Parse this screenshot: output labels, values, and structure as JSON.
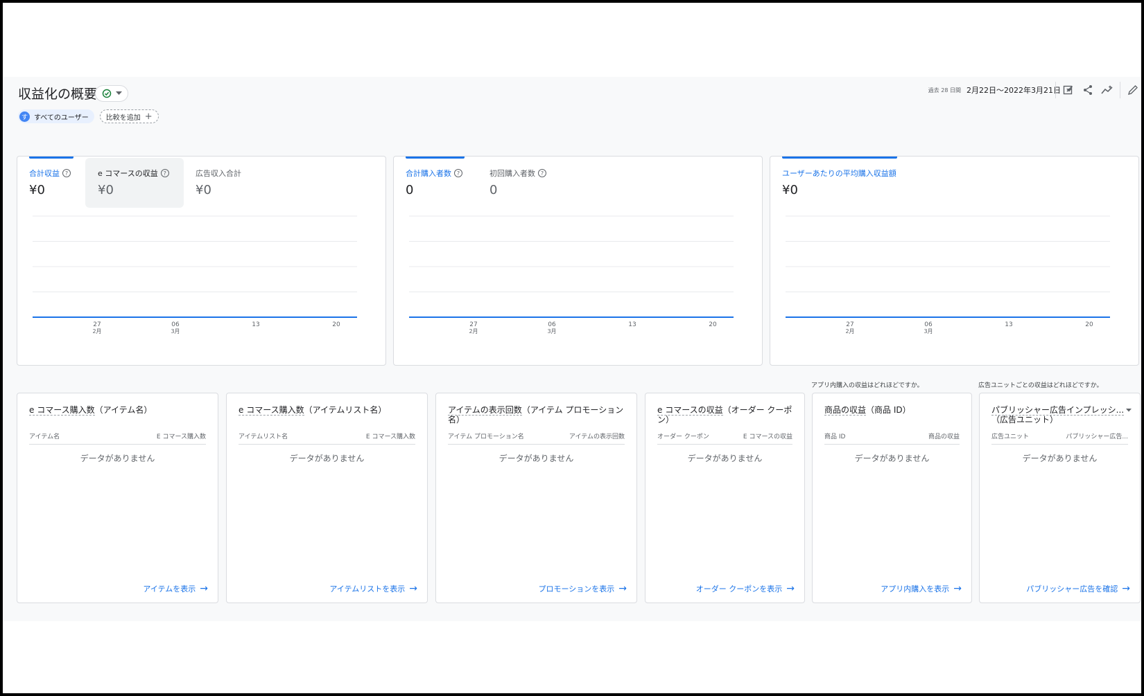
{
  "header": {
    "title": "収益化の概要",
    "date_prefix": "過去 28 日間",
    "date_range": "2月22日～2022年3月21日",
    "segment_label": "すべてのユーザー",
    "segment_avatar": "す",
    "compare_label": "比較を追加"
  },
  "metric_cards": [
    {
      "metrics": [
        {
          "label": "合計収益",
          "value": "¥0"
        },
        {
          "label": "e コマースの収益",
          "value": "¥0"
        },
        {
          "label": "広告収入合計",
          "value": "¥0"
        }
      ]
    },
    {
      "metrics": [
        {
          "label": "合計購入者数",
          "value": "0"
        },
        {
          "label": "初回購入者数",
          "value": "0"
        }
      ]
    },
    {
      "metrics": [
        {
          "label": "ユーザーあたりの平均購入収益額",
          "value": "¥0"
        }
      ]
    }
  ],
  "chart_data": [
    {
      "type": "line",
      "x": [
        "27 2月",
        "06 3月",
        "13",
        "20"
      ],
      "x_tick_days": [
        "27",
        "06",
        "13",
        "20"
      ],
      "x_tick_months": [
        "2月",
        "3月",
        "",
        ""
      ],
      "series": [
        {
          "values": [
            0,
            0,
            0,
            0
          ]
        }
      ],
      "grid": true
    },
    {
      "type": "line",
      "x": [
        "27 2月",
        "06 3月",
        "13",
        "20"
      ],
      "x_tick_days": [
        "27",
        "06",
        "13",
        "20"
      ],
      "x_tick_months": [
        "2月",
        "3月",
        "",
        ""
      ],
      "series": [
        {
          "values": [
            0,
            0,
            0,
            0
          ]
        }
      ],
      "grid": true
    },
    {
      "type": "line",
      "x": [
        "27 2月",
        "06 3月",
        "13",
        "20"
      ],
      "x_tick_days": [
        "27",
        "06",
        "13",
        "20"
      ],
      "x_tick_months": [
        "2月",
        "3月",
        "",
        ""
      ],
      "series": [
        {
          "values": [
            0,
            0,
            0,
            0
          ]
        }
      ],
      "grid": true
    }
  ],
  "questions": {
    "q1": "アプリ内購入の収益はどれほどですか。",
    "q2": "広告ユニットごとの収益はどれほどですか。"
  },
  "bottom_cards": [
    {
      "title_main": "e コマース購入数",
      "title_sub": "（アイテム名）",
      "col1": "アイテム名",
      "col2": "E コマース購入数",
      "empty": "データがありません",
      "link": "アイテムを表示"
    },
    {
      "title_main": "e コマース購入数",
      "title_sub": "（アイテムリスト名）",
      "col1": "アイテムリスト名",
      "col2": "E コマース購入数",
      "empty": "データがありません",
      "link": "アイテムリストを表示"
    },
    {
      "title_main": "アイテムの表示回数",
      "title_sub": "（アイテム プロモーション名）",
      "col1": "アイテム プロモーション名",
      "col2": "アイテムの表示回数",
      "empty": "データがありません",
      "link": "プロモーションを表示"
    },
    {
      "title_main": "e コマースの収益",
      "title_sub": "（オーダー クーポン）",
      "col1": "オーダー クーポン",
      "col2": "E コマースの収益",
      "empty": "データがありません",
      "link": "オーダー クーポンを表示"
    },
    {
      "title_main": "商品の収益",
      "title_sub": "（商品 ID）",
      "col1": "商品 ID",
      "col2": "商品の収益",
      "empty": "データがありません",
      "link": "アプリ内購入を表示"
    },
    {
      "title_main": "パブリッシャー広告インプレッシ...",
      "title_sub": "（広告ユニット）",
      "col1": "広告ユニット",
      "col2": "パブリッシャー広告...",
      "empty": "データがありません",
      "link": "パブリッシャー広告を確認"
    }
  ]
}
